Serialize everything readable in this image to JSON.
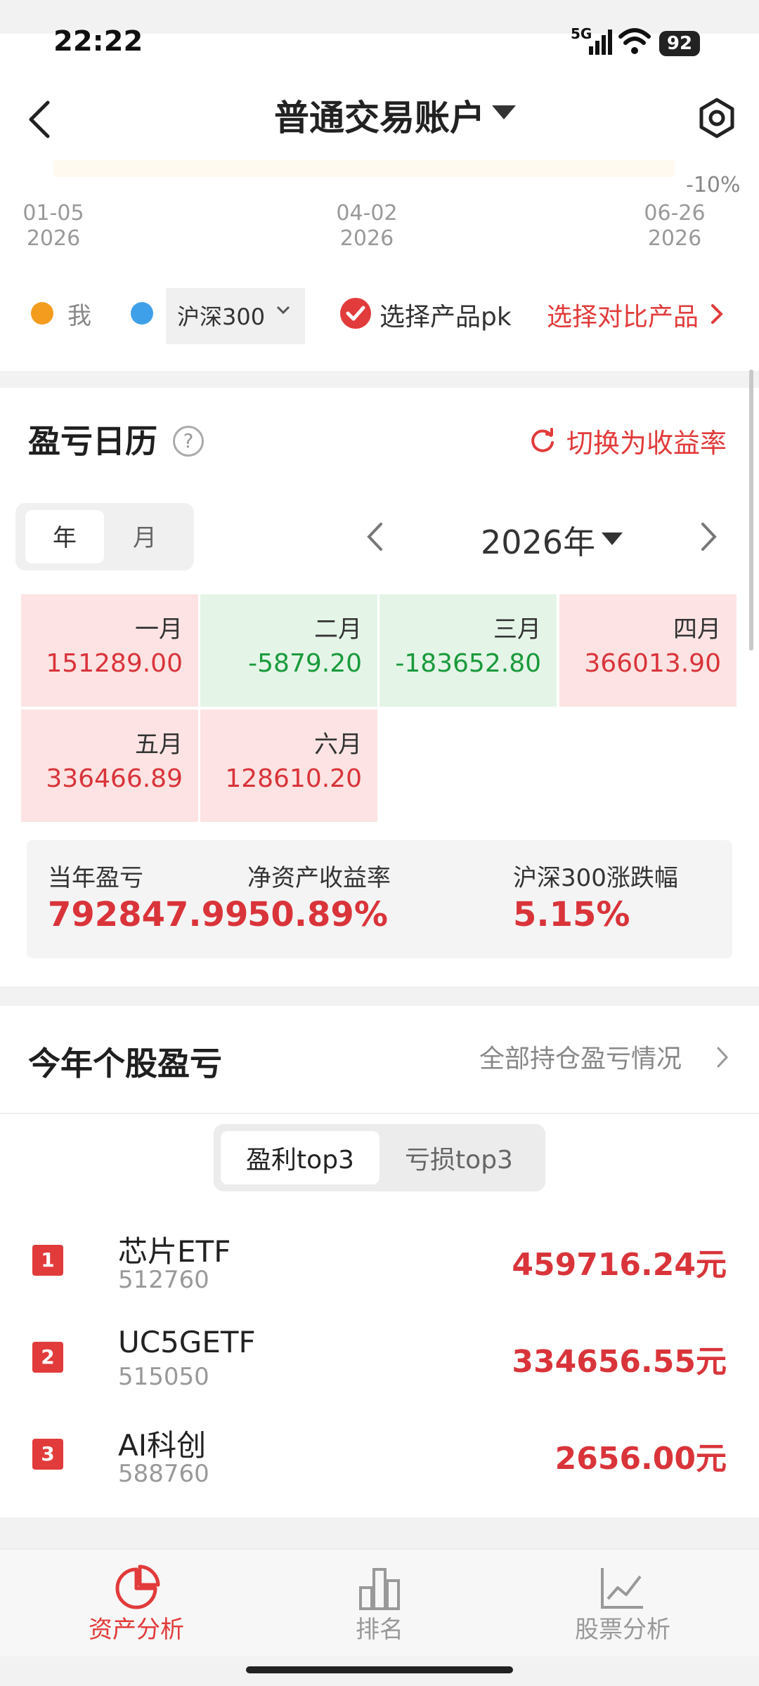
{
  "status_bar": {
    "time": "22:22",
    "network": "5G",
    "battery": "92"
  },
  "header": {
    "title": "普通交易账户"
  },
  "chart": {
    "y_label": "-10%",
    "dates": [
      {
        "md": "01-05",
        "y": "2026"
      },
      {
        "md": "04-02",
        "y": "2026"
      },
      {
        "md": "06-26",
        "y": "2026"
      }
    ]
  },
  "legend": {
    "me": "我",
    "index_select": "沪深300",
    "pk": "选择产品pk",
    "compare": "选择对比产品",
    "colors": {
      "me": "#f39c1e",
      "index": "#3fa0ea"
    }
  },
  "calendar": {
    "title": "盈亏日历",
    "help": "?",
    "switch_label": "切换为收益率",
    "seg_year": "年",
    "seg_month": "月",
    "year_label": "2026年",
    "months": [
      {
        "name": "一月",
        "value": "151289.00",
        "sign": "pos"
      },
      {
        "name": "二月",
        "value": "-5879.20",
        "sign": "neg"
      },
      {
        "name": "三月",
        "value": "-183652.80",
        "sign": "neg"
      },
      {
        "name": "四月",
        "value": "366013.90",
        "sign": "pos"
      },
      {
        "name": "五月",
        "value": "336466.89",
        "sign": "pos"
      },
      {
        "name": "六月",
        "value": "128610.20",
        "sign": "pos"
      }
    ],
    "stats": [
      {
        "label": "当年盈亏",
        "value": "792847.99"
      },
      {
        "label": "净资产收益率",
        "value": "50.89%"
      },
      {
        "label": "沪深300涨跌幅",
        "value": "5.15%"
      }
    ]
  },
  "stocks": {
    "title": "今年个股盈亏",
    "link": "全部持仓盈亏情况",
    "tab_profit": "盈利top3",
    "tab_loss": "亏损top3",
    "items": [
      {
        "rank": "1",
        "name": "芯片ETF",
        "code": "512760",
        "value": "459716.24元"
      },
      {
        "rank": "2",
        "name": "UC5GETF",
        "code": "515050",
        "value": "334656.55元"
      },
      {
        "rank": "3",
        "name": "AI科创",
        "code": "588760",
        "value": "2656.00元"
      }
    ]
  },
  "nav": {
    "items": [
      {
        "label": "资产分析",
        "icon": "pie-chart-icon",
        "active": true
      },
      {
        "label": "排名",
        "icon": "bar-chart-icon",
        "active": false
      },
      {
        "label": "股票分析",
        "icon": "line-chart-icon",
        "active": false
      }
    ],
    "active_color": "#e23b3b"
  }
}
